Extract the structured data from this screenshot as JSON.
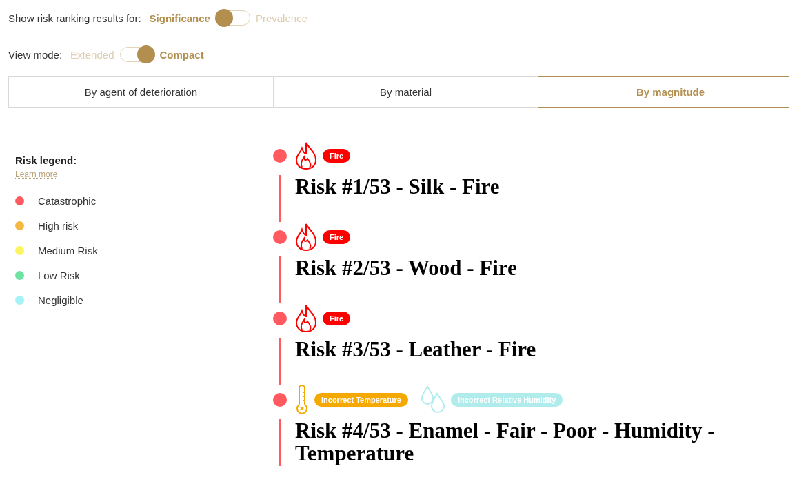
{
  "toggles": [
    {
      "label": "Show risk ranking results for:",
      "options": [
        {
          "label": "Significance",
          "selected": true
        },
        {
          "label": "Prevalence",
          "selected": false
        }
      ]
    },
    {
      "label": "View mode:",
      "options": [
        {
          "label": "Extended",
          "selected": false
        },
        {
          "label": "Compact",
          "selected": true
        }
      ]
    }
  ],
  "tabs": [
    {
      "label": "By agent of deterioration",
      "selected": false
    },
    {
      "label": "By material",
      "selected": false
    },
    {
      "label": "By magnitude",
      "selected": true
    }
  ],
  "legend": {
    "title": "Risk legend:",
    "link": "Learn more",
    "items": [
      {
        "label": "Catastrophic",
        "color": "#ff5a5f"
      },
      {
        "label": "High risk",
        "color": "#f5b942"
      },
      {
        "label": "Medium Risk",
        "color": "#fbf562"
      },
      {
        "label": "Low Risk",
        "color": "#6de3a4"
      },
      {
        "label": "Negligible",
        "color": "#a3f3f7"
      }
    ]
  },
  "risks": [
    {
      "title": "Risk #1/53 - Silk - Fire",
      "color": "#ff5a5f",
      "agents": [
        {
          "kind": "fire",
          "label": "Fire",
          "color": "#ff0000"
        }
      ]
    },
    {
      "title": "Risk #2/53 - Wood - Fire",
      "color": "#ff5a5f",
      "agents": [
        {
          "kind": "fire",
          "label": "Fire",
          "color": "#ff0000"
        }
      ]
    },
    {
      "title": "Risk #3/53 - Leather - Fire",
      "color": "#ff5a5f",
      "agents": [
        {
          "kind": "fire",
          "label": "Fire",
          "color": "#ff0000"
        }
      ]
    },
    {
      "title": "Risk #4/53 - Enamel - Fair - Poor - Humidity - Temperature",
      "color": "#ff5a5f",
      "agents": [
        {
          "kind": "temperature",
          "label": "Incorrect Temperature",
          "color": "#f5a800"
        },
        {
          "kind": "humidity",
          "label": "Incorrect Relative Humidity",
          "color": "#b0ecec"
        }
      ]
    }
  ]
}
